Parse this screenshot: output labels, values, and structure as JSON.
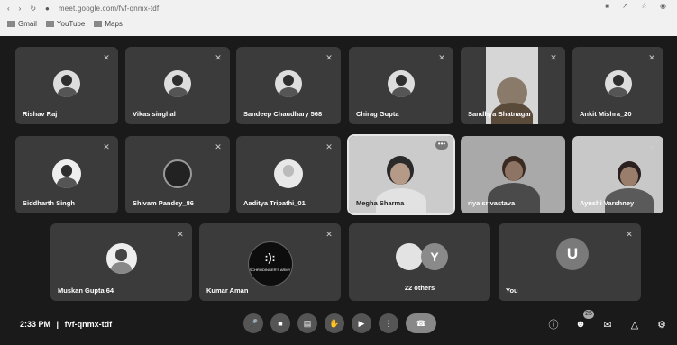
{
  "browser": {
    "url": "meet.google.com/fvf-qnmx-tdf",
    "bookmarks": [
      {
        "label": "Gmail"
      },
      {
        "label": "YouTube"
      },
      {
        "label": "Maps"
      }
    ]
  },
  "tiles": [
    {
      "name": "Rishav Raj"
    },
    {
      "name": "Vikas singhal"
    },
    {
      "name": "Sandeep Chaudhary 568"
    },
    {
      "name": "Chirag Gupta"
    },
    {
      "name": "Sandhya Bhatnagar"
    },
    {
      "name": "Ankit Mishra_20"
    },
    {
      "name": "Siddharth Singh"
    },
    {
      "name": "Shivam Pandey_86"
    },
    {
      "name": "Aaditya Tripathi_01"
    },
    {
      "name": "Megha Sharma"
    },
    {
      "name": "riya srivastava"
    },
    {
      "name": "Ayushi Varshney"
    },
    {
      "name": "Muskan Gupta 64"
    },
    {
      "name": "Kumar Aman"
    },
    {
      "name": "22 others",
      "avatar_letter": "Y"
    },
    {
      "name": "You",
      "avatar_letter": "U"
    }
  ],
  "meeting": {
    "time": "2:33 PM",
    "separator": "|",
    "code": "fvf-qnmx-tdf",
    "participant_badge": "25"
  },
  "logo_text": "SCHRÖDINGER'S ARMY"
}
